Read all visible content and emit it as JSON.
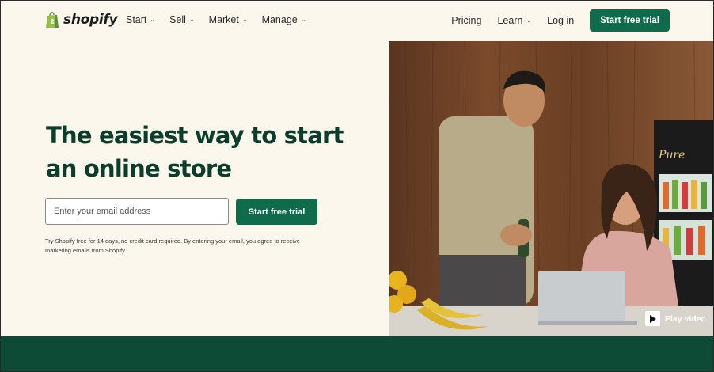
{
  "header": {
    "brand": "shopify",
    "nav_left": [
      {
        "label": "Start",
        "has_dropdown": true
      },
      {
        "label": "Sell",
        "has_dropdown": true
      },
      {
        "label": "Market",
        "has_dropdown": true
      },
      {
        "label": "Manage",
        "has_dropdown": true
      }
    ],
    "pricing": "Pricing",
    "learn": "Learn",
    "login": "Log in",
    "cta": "Start free trial"
  },
  "hero": {
    "headline_line1": "The easiest way to start",
    "headline_line2": "an online store",
    "email_placeholder": "Enter your email address",
    "email_value": "",
    "cta": "Start free trial",
    "disclaimer": "Try Shopify free for 14 days, no credit card required. By entering your email, you agree to receive marketing emails from Shopify.",
    "play_video": "Play video",
    "shop_sign": "Pure"
  },
  "colors": {
    "accent": "#0f6b4c",
    "headline": "#0b3d2c",
    "background": "#fbf7ed",
    "band": "#0d4b37"
  },
  "icons": {
    "chevron": "chevron-down-icon",
    "logo": "shopping-bag-icon",
    "play": "play-icon"
  }
}
